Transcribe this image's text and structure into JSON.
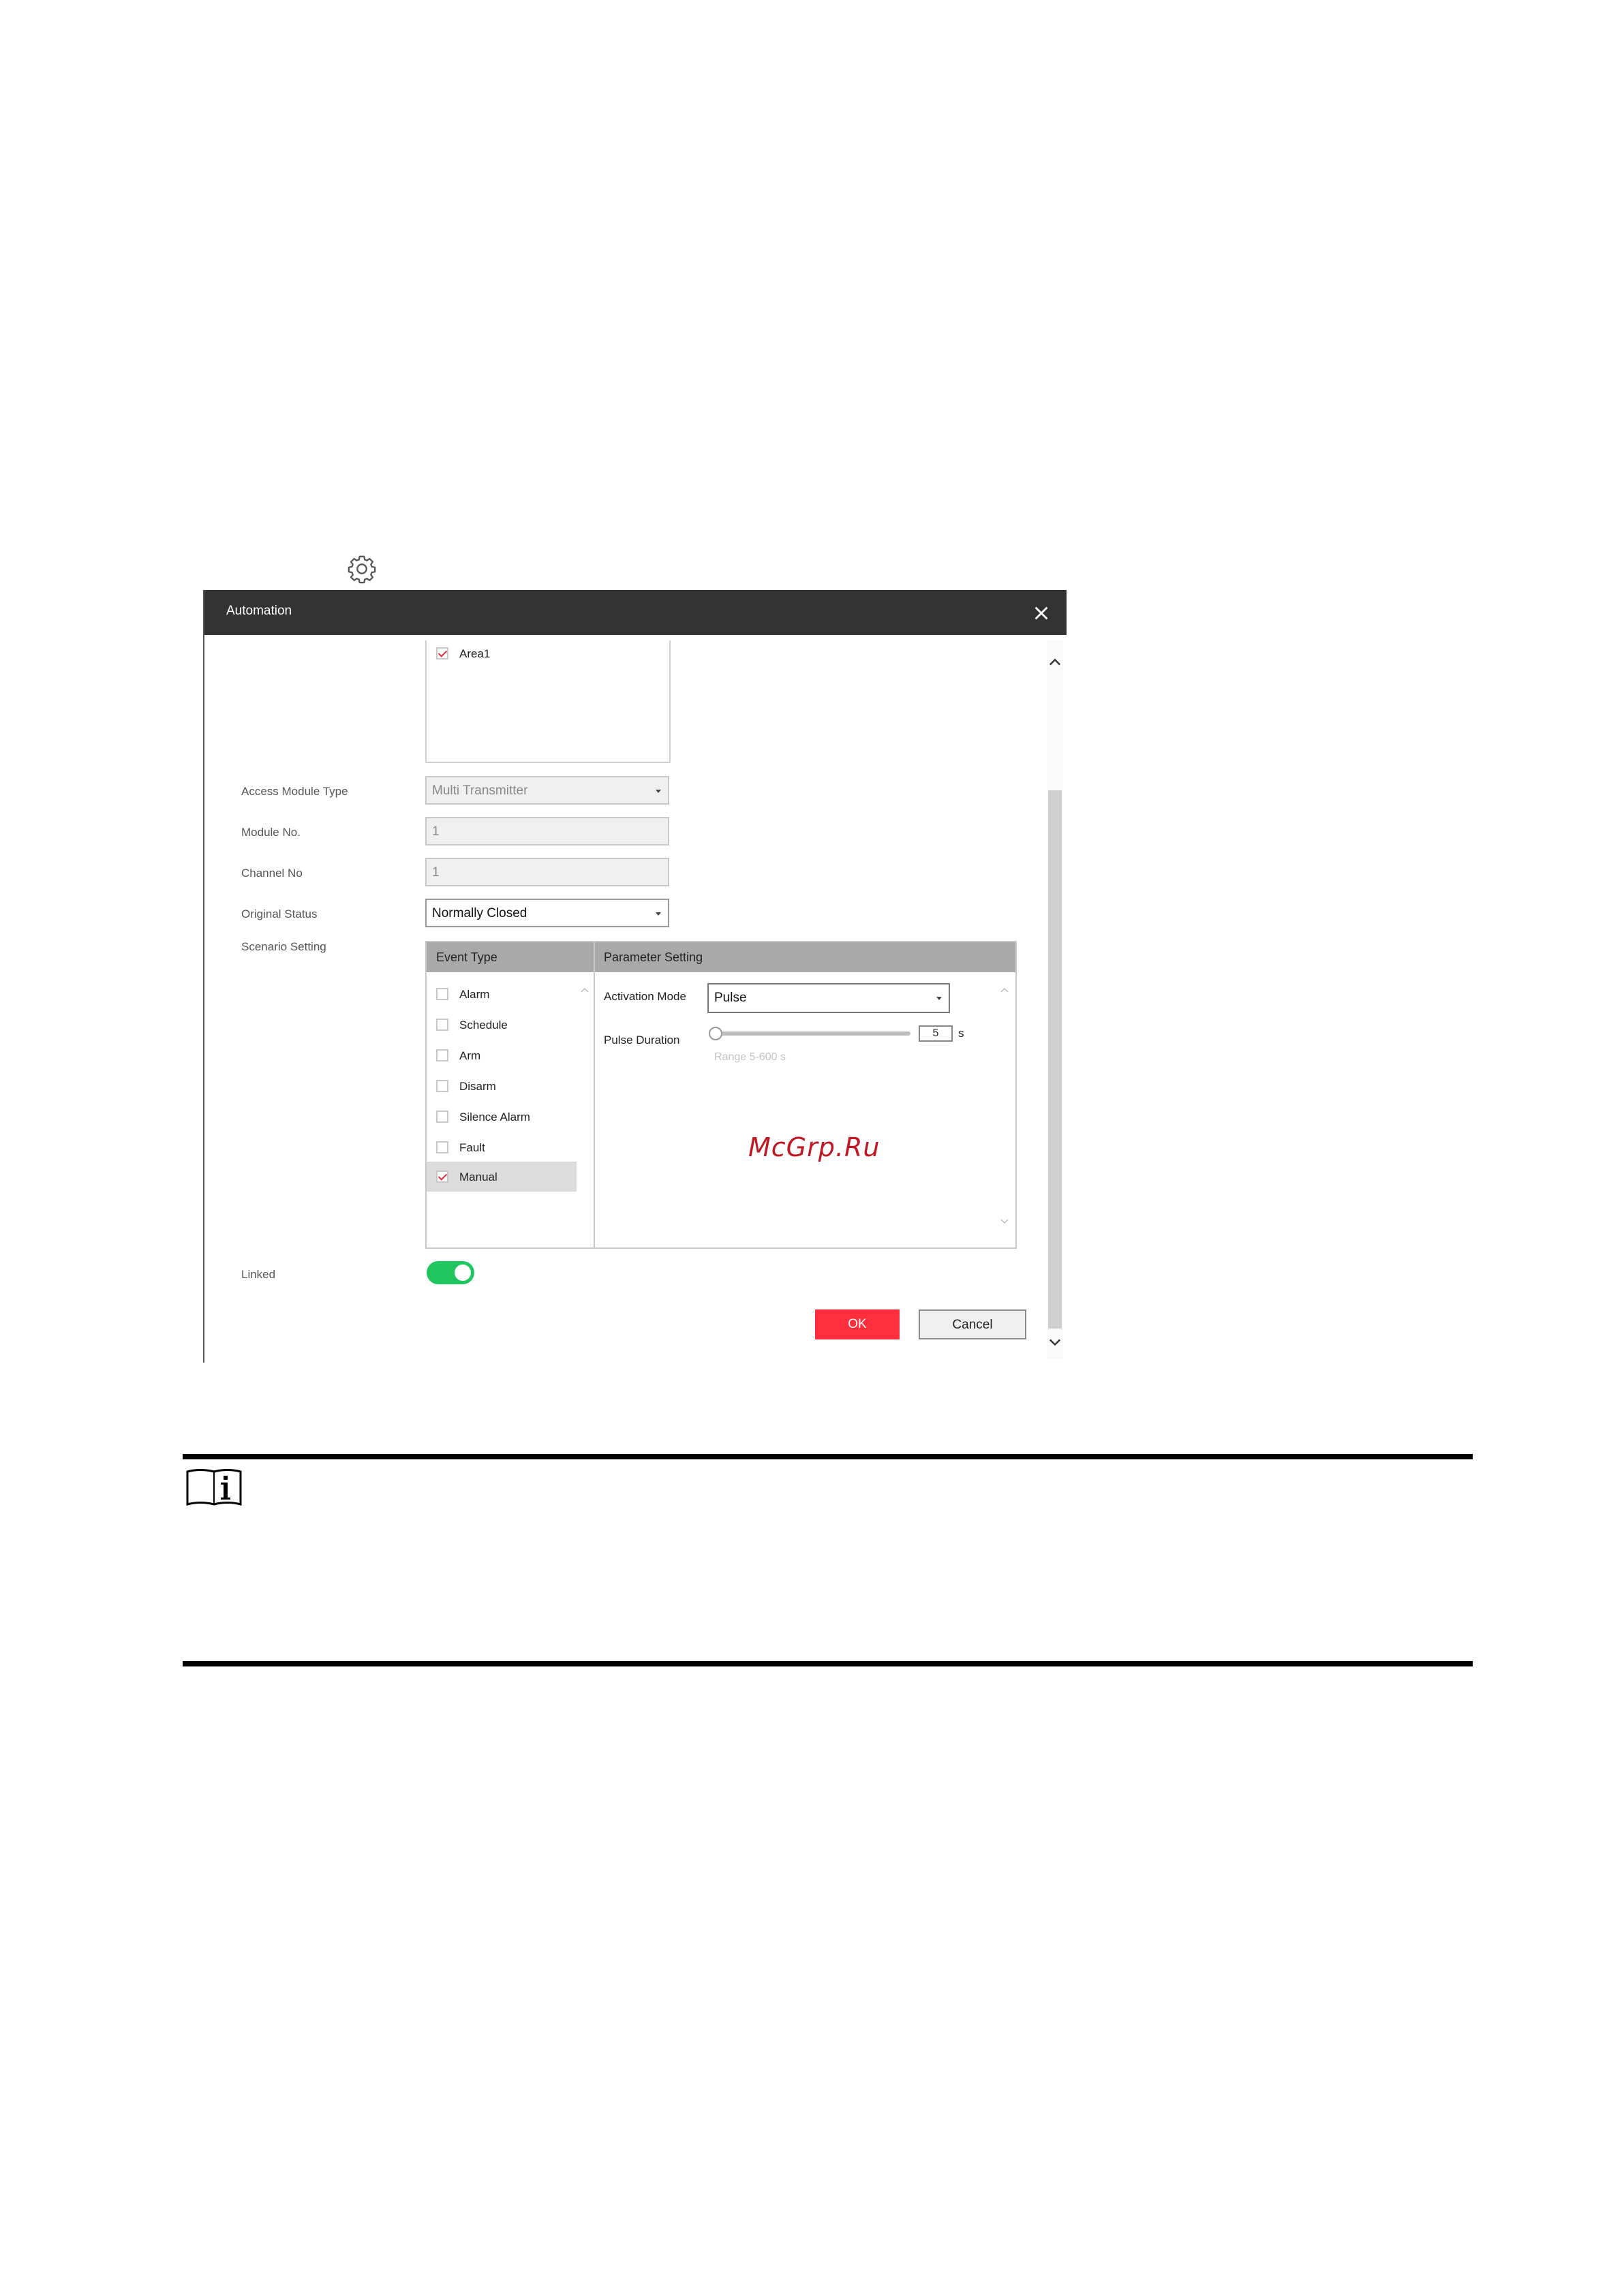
{
  "dialog": {
    "title": "Automation",
    "area_item": {
      "label": "Area1",
      "checked": true
    },
    "access_module_type": {
      "label": "Access Module Type",
      "value": "Multi Transmitter"
    },
    "module_no": {
      "label": "Module No.",
      "value": "1"
    },
    "channel_no": {
      "label": "Channel No",
      "value": "1"
    },
    "original_status": {
      "label": "Original Status",
      "value": "Normally Closed"
    },
    "scenario_setting": {
      "label": "Scenario Setting",
      "event_type_header": "Event Type",
      "parameter_setting_header": "Parameter Setting",
      "events": [
        {
          "label": "Alarm",
          "checked": false
        },
        {
          "label": "Schedule",
          "checked": false
        },
        {
          "label": "Arm",
          "checked": false
        },
        {
          "label": "Disarm",
          "checked": false
        },
        {
          "label": "Silence Alarm",
          "checked": false
        },
        {
          "label": "Fault",
          "checked": false
        },
        {
          "label": "Manual",
          "checked": true,
          "selected": true
        }
      ],
      "activation_mode": {
        "label": "Activation Mode",
        "value": "Pulse"
      },
      "pulse_duration": {
        "label": "Pulse Duration",
        "value": "5",
        "unit": "s",
        "range_hint": "Range 5-600 s",
        "slider_fraction": 0
      }
    },
    "linked": {
      "label": "Linked",
      "on": true
    },
    "ok_label": "OK",
    "cancel_label": "Cancel"
  },
  "watermark": "McGrp.Ru",
  "colors": {
    "titlebar": "#333333",
    "ok_button": "#ff2e3d",
    "toggle_on": "#1fc660",
    "check_mark": "#e0323c",
    "table_header": "#a9a9a9",
    "watermark": "#c01822"
  },
  "icons": [
    "gear-icon",
    "close-icon",
    "note-info-icon",
    "chevron-up-icon",
    "chevron-down-icon",
    "dropdown-caret-icon"
  ]
}
